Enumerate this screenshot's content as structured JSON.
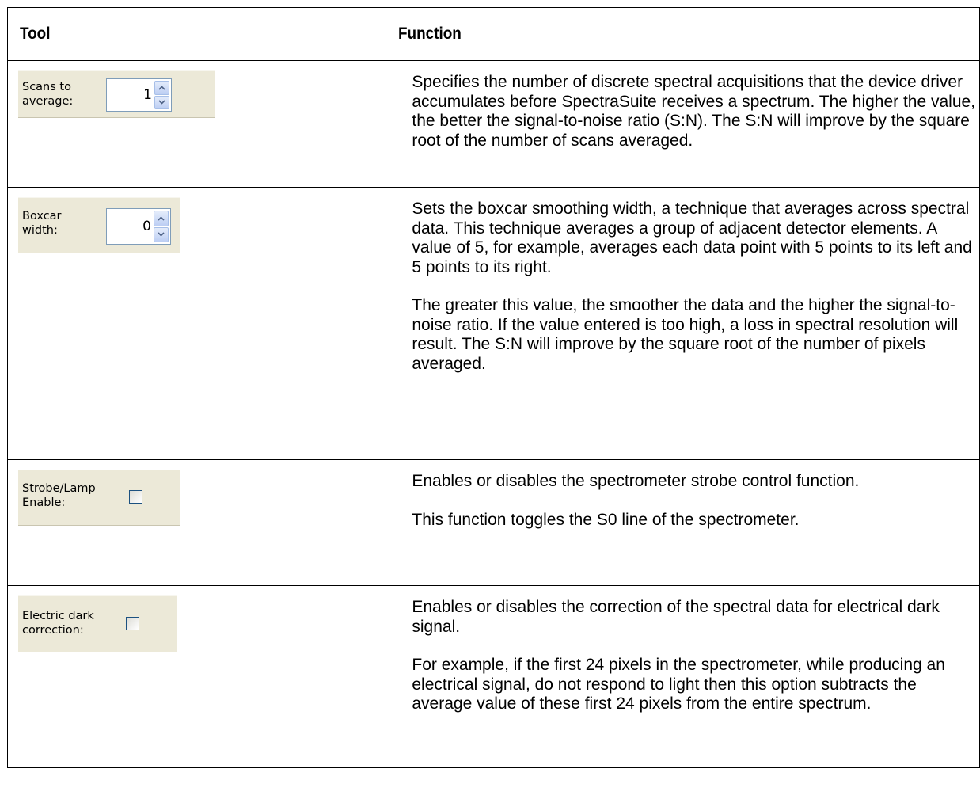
{
  "table": {
    "header": {
      "tool": "Tool",
      "function": "Function"
    },
    "rows": [
      {
        "widget": {
          "type": "spinner",
          "label_lines": [
            "Scans to",
            "average:"
          ],
          "value": "1",
          "up_icon": "chevron-up-icon",
          "down_icon": "chevron-down-icon"
        },
        "paragraphs": [
          "Specifies the number of discrete spectral acquisitions that the device driver accumulates before SpectraSuite receives a spectrum. The higher the value, the better the signal-to-noise ratio (S:N). The S:N will improve by the square root of the number of scans averaged."
        ]
      },
      {
        "widget": {
          "type": "spinner",
          "label_lines": [
            "Boxcar",
            "width:"
          ],
          "value": "0",
          "up_icon": "chevron-up-icon",
          "down_icon": "chevron-down-icon"
        },
        "paragraphs": [
          "Sets the boxcar smoothing width, a technique that averages across spectral data. This technique averages a group of adjacent detector elements. A value of 5, for example, averages each data point with 5 points to its left and 5 points to its right.",
          "The greater this value, the smoother the data and the higher the signal-to-noise ratio. If the value entered is too high, a loss in spectral resolution will result. The S:N will improve by the square root of the number of pixels averaged."
        ]
      },
      {
        "widget": {
          "type": "checkbox",
          "label_lines": [
            "Strobe/Lamp",
            "Enable:"
          ],
          "checked": false
        },
        "paragraphs": [
          "Enables or disables the spectrometer strobe control function.",
          "This function toggles the S0 line of the spectrometer."
        ]
      },
      {
        "widget": {
          "type": "checkbox",
          "label_lines": [
            "Electric dark",
            "correction:"
          ],
          "checked": false
        },
        "paragraphs": [
          "Enables or disables the correction of the spectral data for electrical dark signal.",
          "For example, if the first 24 pixels in the spectrometer, while producing an electrical signal, do not respond to light then this option subtracts the average value of these first 24 pixels from the entire spectrum."
        ]
      }
    ]
  },
  "colors": {
    "widget_bg": "#ece9d8",
    "spinner_border": "#7f9db9",
    "checkbox_border": "#1c5180",
    "spin_button": "#bccef3"
  }
}
